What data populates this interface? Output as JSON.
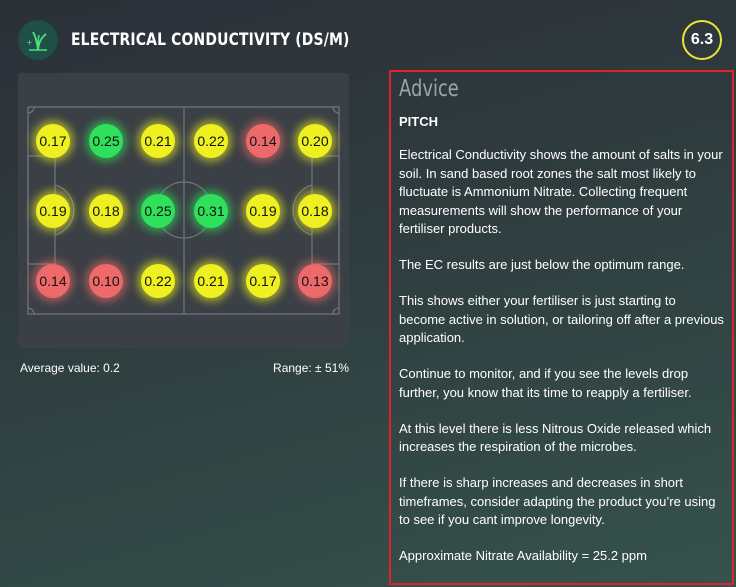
{
  "header": {
    "title": "ELECTRICAL CONDUCTIVITY (DS/M)",
    "score": "6.3",
    "logo_icon": "grass-plant-icon"
  },
  "pitch": {
    "markers": [
      {
        "value": "0.17",
        "status": "yellow"
      },
      {
        "value": "0.25",
        "status": "green"
      },
      {
        "value": "0.21",
        "status": "yellow"
      },
      {
        "value": "0.22",
        "status": "yellow"
      },
      {
        "value": "0.14",
        "status": "red"
      },
      {
        "value": "0.20",
        "status": "yellow"
      },
      {
        "value": "0.19",
        "status": "yellow"
      },
      {
        "value": "0.18",
        "status": "yellow"
      },
      {
        "value": "0.25",
        "status": "green"
      },
      {
        "value": "0.31",
        "status": "green"
      },
      {
        "value": "0.19",
        "status": "yellow"
      },
      {
        "value": "0.18",
        "status": "yellow"
      },
      {
        "value": "0.14",
        "status": "red"
      },
      {
        "value": "0.10",
        "status": "red"
      },
      {
        "value": "0.22",
        "status": "yellow"
      },
      {
        "value": "0.21",
        "status": "yellow"
      },
      {
        "value": "0.17",
        "status": "yellow"
      },
      {
        "value": "0.13",
        "status": "red"
      }
    ]
  },
  "stats": {
    "average": "Average value: 0.2",
    "range": "Range: ± 51%"
  },
  "advice": {
    "heading": "Advice",
    "subheading": "PITCH",
    "paragraphs": [
      "Electrical Conductivity shows the amount of salts in your soil. In sand based root zones the salt most likely to fluctuate is Ammonium Nitrate. Collecting frequent measurements will show the performance of your fertiliser products.",
      "The EC results are just below the optimum range.",
      "This shows either your fertiliser is just starting to become active in solution, or tailoring off after a previous application.",
      "Continue to monitor, and if you see the levels drop further, you know that its time to reapply a fertiliser.",
      "At this level there is less Nitrous Oxide released which increases the respiration of the microbes.",
      "If there is sharp increases and decreases in short timeframes, consider adapting the product you’re using to see if you cant improve longevity.",
      "Approximate Nitrate Availability = 25.2 ppm"
    ]
  },
  "colors": {
    "yellow": "#eef11f",
    "green": "#2fe05a",
    "red": "#ee6a6a",
    "advice_border": "#e0222a",
    "score_ring": "#e9e633"
  }
}
